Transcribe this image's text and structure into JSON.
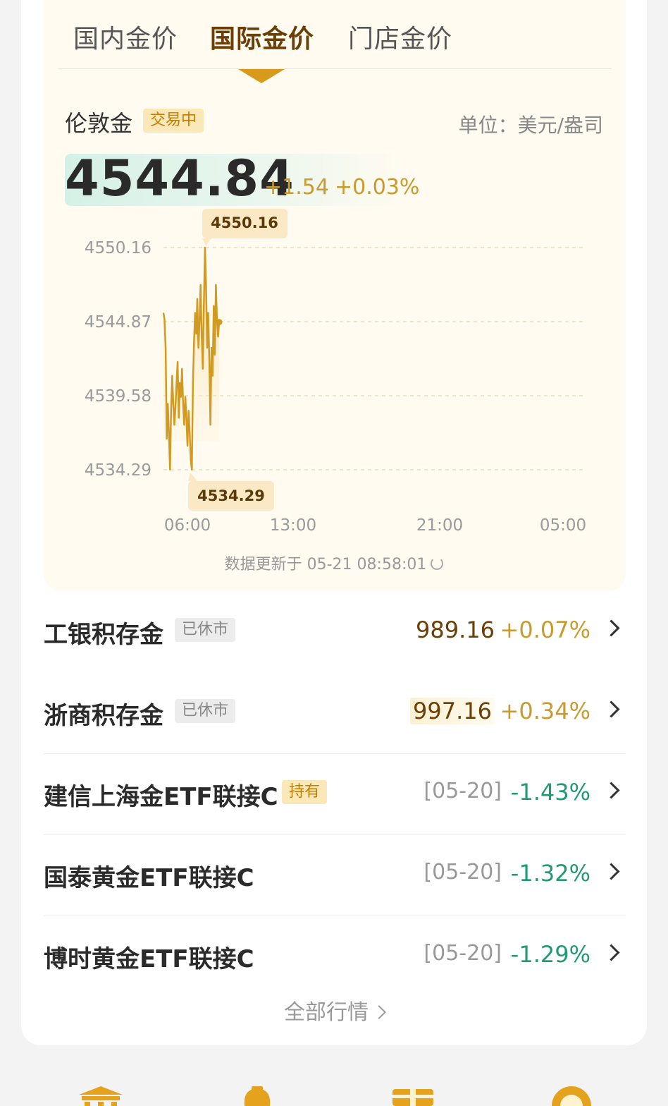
{
  "tabs": [
    {
      "label": "国内金价",
      "active": false
    },
    {
      "label": "国际金价",
      "active": true
    },
    {
      "label": "门店金价",
      "active": false
    }
  ],
  "quote": {
    "name": "伦敦金",
    "status": "交易中",
    "unit": "单位：美元/盎司",
    "price": "4544.84",
    "change": "+1.54",
    "change_pct": "+0.03%"
  },
  "chart_data": {
    "type": "line",
    "y_ticks": [
      "4550.16",
      "4544.87",
      "4539.58",
      "4534.29"
    ],
    "x_ticks": [
      "06:00",
      "13:00",
      "21:00",
      "05:00"
    ],
    "ylim": [
      4534.29,
      4550.16
    ],
    "high_label": "4550.16",
    "low_label": "4534.29",
    "series": [
      {
        "values": [
          4545.5,
          4545.0,
          4543.0,
          4536.5,
          4539.0,
          4537.0,
          4534.3,
          4538.5,
          4541.0,
          4539.0,
          4537.5,
          4538.8,
          4540.5,
          4542.0,
          4538.0,
          4540.5,
          4539.5,
          4541.5,
          4539.0,
          4537.5,
          4539.5,
          4538.0,
          4536.0,
          4538.5,
          4537.0,
          4535.0,
          4534.3,
          4540.5,
          4543.5,
          4545.5,
          4544.0,
          4546.5,
          4543.0,
          4544.8,
          4547.5,
          4544.0,
          4541.5,
          4546.0,
          4550.16,
          4547.5,
          4543.0,
          4545.5,
          4542.0,
          4537.5,
          4543.0,
          4541.0,
          4546.0,
          4542.5,
          4547.5,
          4545.0,
          4543.8,
          4544.84
        ]
      }
    ]
  },
  "updated": "数据更新于 05-21 08:58:01",
  "products": [
    {
      "name": "工银积存金",
      "tag": "已休市",
      "tag_type": "closed",
      "value": "989.16",
      "change": "+0.07%",
      "dir": "up"
    },
    {
      "name": "浙商积存金",
      "tag": "已休市",
      "tag_type": "closed",
      "value": "997.16",
      "change": "+0.34%",
      "dir": "up"
    },
    {
      "name": "建信上海金ETF联接C",
      "tag": "持有",
      "tag_type": "hold",
      "date": "[05-20]",
      "change": "-1.43%",
      "dir": "down"
    },
    {
      "name": "国泰黄金ETF联接C",
      "date": "[05-20]",
      "change": "-1.32%",
      "dir": "down"
    },
    {
      "name": "博时黄金ETF联接C",
      "date": "[05-20]",
      "change": "-1.29%",
      "dir": "down"
    }
  ],
  "all_market": "全部行情",
  "colors": {
    "gold": "#c99a2c",
    "down": "#1f9a74",
    "brown": "#6b3e06"
  }
}
